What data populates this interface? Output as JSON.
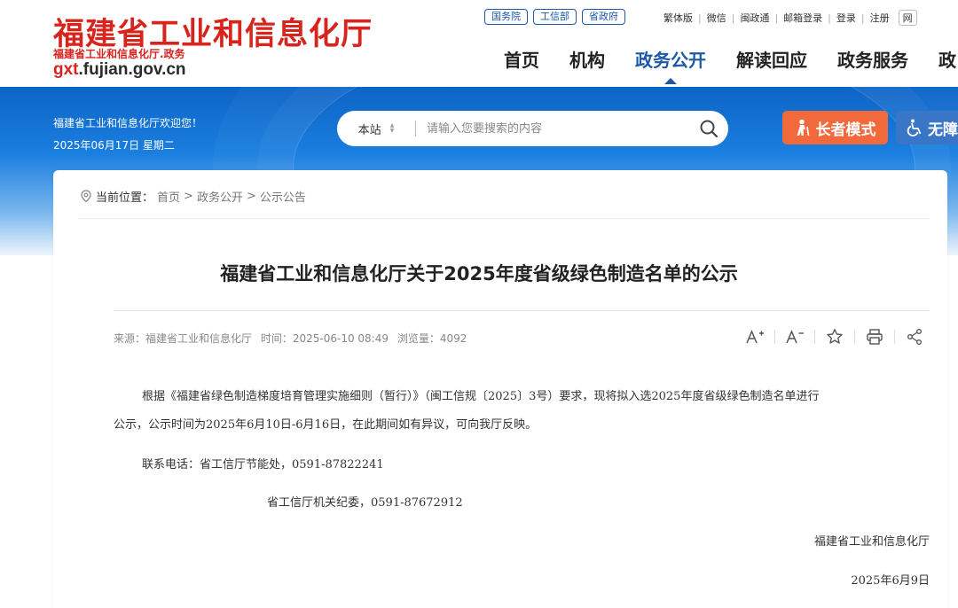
{
  "header": {
    "logo_title": "福建省工业和信息化厅",
    "logo_subtitle": "福建省工业和信息化厅.政务",
    "logo_domain_prefix": "gxt",
    "logo_domain_rest": ".fujian.gov.cn",
    "gov_links": [
      "国务院",
      "工信部",
      "省政府"
    ],
    "top_links": [
      "繁体版",
      "微信",
      "闽政通",
      "邮箱登录",
      "登录",
      "注册"
    ],
    "top_links_extra": "网",
    "nav": [
      "首页",
      "机构",
      "政务公开",
      "解读回应",
      "政务服务",
      "政"
    ],
    "nav_active_index": 2
  },
  "banner": {
    "welcome": "福建省工业和信息化厅欢迎您！",
    "date": "2025年06月17日 星期二",
    "search": {
      "scope": "本站",
      "placeholder": "请输入您要搜索的内容"
    },
    "elder_mode_label": "长者模式",
    "accessibility_label": "无障"
  },
  "breadcrumb": {
    "label": "当前位置：",
    "items": [
      "首页",
      "政务公开",
      "公示公告"
    ]
  },
  "article": {
    "title": "福建省工业和信息化厅关于2025年度省级绿色制造名单的公示",
    "meta": {
      "source": "来源：福建省工业和信息化厅",
      "time": "时间：2025-06-10 08:49",
      "views": "浏览量：4092"
    },
    "para1_line1": "根据《福建省绿色制造梯度培育管理实施细则（暂行）》（闽工信规〔2025〕3号）要求，现将拟入选2025年度省级绿色制造名单进行",
    "para1_line2": "公示，公示时间为2025年6月10日-6月16日，在此期间如有异议，可向我厅反映。",
    "contact1": "联系电话：省工信厅节能处，0591-87822241",
    "contact2": "省工信厅机关纪委，0591-87672912",
    "signature": "福建省工业和信息化厅",
    "sign_date": "2025年6月9日"
  },
  "colors": {
    "brand_red": "#d7241d",
    "brand_blue": "#1b58a8",
    "elder_orange": "#f26a3c"
  }
}
